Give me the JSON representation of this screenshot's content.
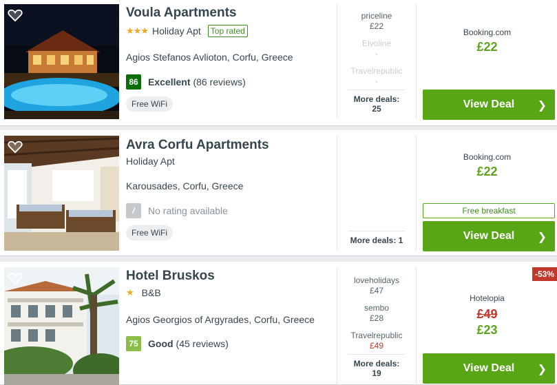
{
  "hotels": [
    {
      "name": "Voula Apartments",
      "stars": "★★★",
      "type": "Holiday Apt",
      "badge": "Top rated",
      "address": "Agios Stefanos Avlioton, Corfu, Greece",
      "score": "86",
      "rating_word": "Excellent",
      "reviews": "(86 reviews)",
      "amenity": "Free WiFi",
      "deals": [
        {
          "name": "priceline",
          "price": "£22"
        },
        {
          "name": "Elvoline",
          "price": "-"
        },
        {
          "name": "Travelrepublic",
          "price": "-"
        }
      ],
      "more_deals": "More deals: 25",
      "provider": "Booking.com",
      "price": "£22",
      "cta": "View Deal"
    },
    {
      "name": "Avra Corfu Apartments",
      "type": "Holiday Apt",
      "address": "Karousades, Corfu, Greece",
      "score": "/",
      "no_rating": "No rating available",
      "amenity": "Free WiFi",
      "more_deals": "More deals: 1",
      "provider": "Booking.com",
      "price": "£22",
      "perk": "Free breakfast",
      "cta": "View Deal"
    },
    {
      "name": "Hotel Bruskos",
      "stars": "★",
      "type": "B&B",
      "address": "Agios Georgios of Argyrades, Corfu, Greece",
      "score": "75",
      "rating_word": "Good",
      "reviews": "(45 reviews)",
      "deals": [
        {
          "name": "loveholidays",
          "price": "£47"
        },
        {
          "name": "sembo",
          "price": "£28"
        },
        {
          "name": "Travelrepublic",
          "price": "£49"
        }
      ],
      "more_deals": "More deals: 19",
      "discount": "-53%",
      "provider": "Hotelopia",
      "old_price": "£49",
      "price": "£23",
      "cta": "View Deal"
    }
  ],
  "colors": {
    "accent_green": "#58a515",
    "price_green": "#5fa31e",
    "deal_red": "#c0392b",
    "score_excellent": "#0b6e0b",
    "score_good": "#8bbd48"
  },
  "icons": {
    "favorite": "heart-icon",
    "chevron": "chevron-right-icon"
  }
}
